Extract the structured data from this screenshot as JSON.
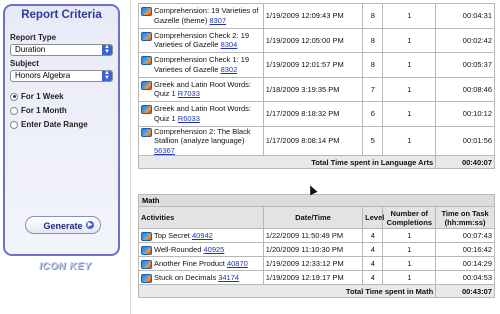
{
  "sidebar": {
    "title": "Report Criteria",
    "report_type_label": "Report Type",
    "report_type_value": "Duration",
    "subject_label": "Subject",
    "subject_value": "Honors Algebra",
    "radios": [
      {
        "label": "For 1 Week",
        "selected": true
      },
      {
        "label": "For 1 Month",
        "selected": false
      },
      {
        "label": "Enter Date Range",
        "selected": false
      }
    ],
    "generate_label": "Generate",
    "logo_text": "ICON KEY"
  },
  "language_arts": {
    "rows": [
      {
        "activity": "Comprehension: 19 Varieties of Gazelle (theme)",
        "id": "8307",
        "date": "1/19/2009 12:09:43 PM",
        "level": "8",
        "completions": "1",
        "time": "00:04:31"
      },
      {
        "activity": "Comprehension Check 2: 19 Varieties of Gazelle",
        "id": "8304",
        "date": "1/19/2009 12:05:00 PM",
        "level": "8",
        "completions": "1",
        "time": "00:02:42"
      },
      {
        "activity": "Comprehension Check 1: 19 Varieties of Gazelle",
        "id": "8302",
        "date": "1/19/2009 12:01:57 PM",
        "level": "8",
        "completions": "1",
        "time": "00:05:37"
      },
      {
        "activity": "Greek and Latin Root Words: Quiz 1",
        "id": "R7033",
        "date": "1/18/2009 3:19:35 PM",
        "level": "7",
        "completions": "1",
        "time": "00:08:46"
      },
      {
        "activity": "Greek and Latin Root Words: Quiz 1",
        "id": "R6033",
        "date": "1/17/2009 8:18:32 PM",
        "level": "6",
        "completions": "1",
        "time": "00:10:12"
      },
      {
        "activity": "Comprehension 2: The Black Stallion (analyze language)",
        "id": "56367",
        "date": "1/17/2009 8:08:14 PM",
        "level": "5",
        "completions": "1",
        "time": "00:01:56"
      }
    ],
    "total_label": "Total Time spent in Language Arts",
    "total_value": "00:40:07"
  },
  "math": {
    "section_title": "Math",
    "headers": {
      "activities": "Activities",
      "date": "Date/Time",
      "level": "Level",
      "completions": "Number of Completions",
      "time": "Time on Task (hh:mm:ss)"
    },
    "rows": [
      {
        "activity": "Top Secret",
        "id": "40942",
        "date": "1/22/2009 11:50:49 PM",
        "level": "4",
        "completions": "1",
        "time": "00:07:43"
      },
      {
        "activity": "Well-Rounded",
        "id": "40925",
        "date": "1/20/2009 11:10:30 PM",
        "level": "4",
        "completions": "1",
        "time": "00:16:42"
      },
      {
        "activity": "Another Fine Product",
        "id": "40870",
        "date": "1/19/2009 12:33:12 PM",
        "level": "4",
        "completions": "1",
        "time": "00:14:29"
      },
      {
        "activity": "Stuck on Decimals",
        "id": "34174",
        "date": "1/19/2009 12:19:17 PM",
        "level": "4",
        "completions": "1",
        "time": "00:04:53"
      }
    ],
    "total_label": "Total Time spent in Math",
    "total_value": "00:43:07"
  },
  "icons": {
    "activity_icon": "rocket-icon",
    "select_arrow": "chevron-updown-icon",
    "generate_arrow": "chevron-right-icon"
  },
  "colors": {
    "accent": "#6d72c8",
    "title": "#2f3aa3",
    "link": "#1b35b5"
  }
}
